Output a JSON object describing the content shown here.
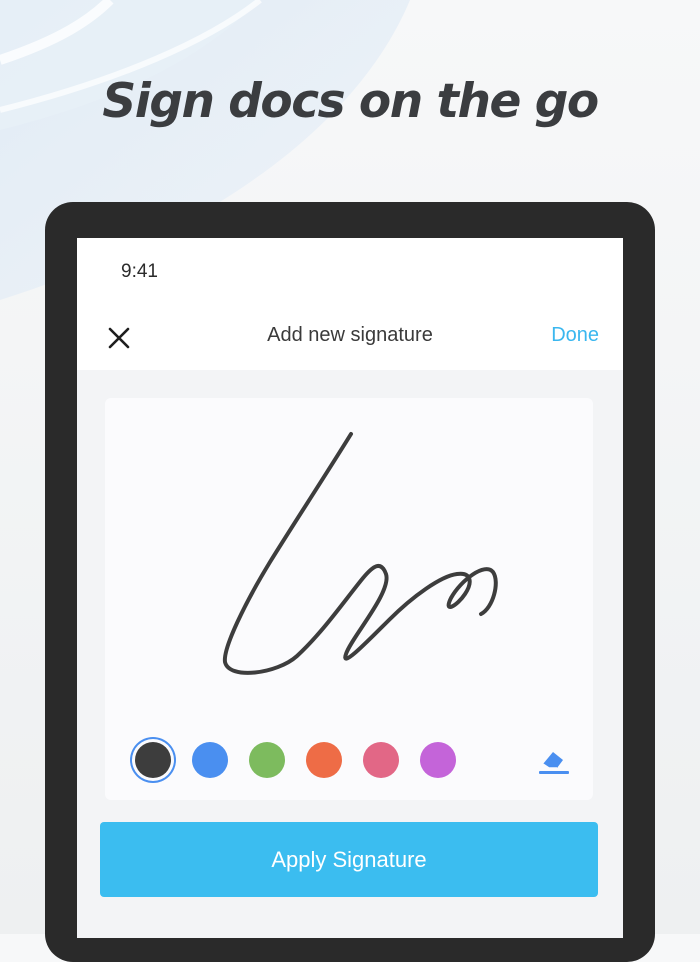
{
  "headline": "Sign docs on the go",
  "status_bar": {
    "time": "9:41"
  },
  "nav": {
    "close_icon": "close-icon",
    "title": "Add new signature",
    "done_label": "Done"
  },
  "colors": {
    "accent": "#3bbdf0",
    "done": "#3bb7ef",
    "ink": "#3d3d3d",
    "selected_ring": "#4a8ff0"
  },
  "swatches": [
    {
      "name": "black",
      "color": "#3d3d3d",
      "selected": true
    },
    {
      "name": "blue",
      "color": "#4a8ff0",
      "selected": false
    },
    {
      "name": "green",
      "color": "#7dbb5e",
      "selected": false
    },
    {
      "name": "orange",
      "color": "#ee6c46",
      "selected": false
    },
    {
      "name": "pink",
      "color": "#e26786",
      "selected": false
    },
    {
      "name": "purple",
      "color": "#c464d9",
      "selected": false
    }
  ],
  "eraser_icon": "eraser-icon",
  "apply_label": "Apply Signature"
}
